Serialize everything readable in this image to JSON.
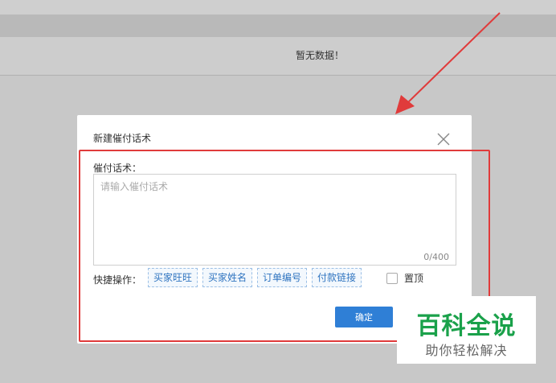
{
  "page": {
    "empty_text": "暂无数据！"
  },
  "dialog": {
    "title": "新建催付话术",
    "field_label": "催付话术：",
    "textarea": {
      "value": "",
      "placeholder": "请输入催付话术"
    },
    "char_count": "0/400",
    "quick_label": "快捷操作：",
    "quick_tags": [
      {
        "label": "买家旺旺"
      },
      {
        "label": "买家姓名"
      },
      {
        "label": "订单编号"
      },
      {
        "label": "付款链接"
      }
    ],
    "pin": {
      "label": "置顶",
      "checked": false
    },
    "confirm_label": "确定"
  },
  "watermark": {
    "main": "百科全说",
    "sub": "助你轻松解决"
  },
  "colors": {
    "accent": "#2f7fd6",
    "highlight": "#e03b3b",
    "watermark_green": "#1aa14a"
  }
}
